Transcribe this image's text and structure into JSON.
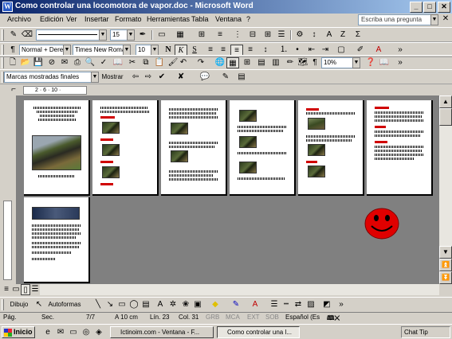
{
  "window": {
    "title": "Como controlar una locomotora  de vapor.doc - Microsoft Word",
    "app_icon": "word-icon"
  },
  "menubar": {
    "items": [
      "Archivo",
      "Edición",
      "Ver",
      "Insertar",
      "Formato",
      "Herramientas",
      "Tabla",
      "Ventana",
      "?"
    ],
    "ask_placeholder": "Escriba una pregunta"
  },
  "toolbar_draw_top": {
    "zoom_line": "",
    "font_size": "15"
  },
  "toolbar_format": {
    "style": "Normal + Derec",
    "font": "Times New Roman",
    "size": "10"
  },
  "toolbar_standard": {
    "zoom": "10%"
  },
  "toolbar_review": {
    "markup_view": "Marcas mostradas finales",
    "show_label": "Mostrar"
  },
  "ruler": {
    "marks": "2 · 6 · 10 ·"
  },
  "document": {
    "page_count": 7,
    "page1": {
      "title_lines": 3
    }
  },
  "drawbar": {
    "draw_label": "Dibujo",
    "autoshapes_label": "Autoformas"
  },
  "statusbar": {
    "page": "Pág.",
    "section": "Sec.",
    "pages": "7/7",
    "at": "A 10 cm",
    "line": "Lín. 23",
    "col": "Col. 31",
    "grb": "GRB",
    "mca": "MCA",
    "ext": "EXT",
    "sob": "SOB",
    "lang": "Español (Es"
  },
  "taskbar": {
    "start": "Inicio",
    "tasks": [
      "Ictinoim.com - Ventana - F...",
      "Como controlar una l..."
    ],
    "clock": "Chat Tip"
  },
  "colors": {
    "title_start": "#0a246a",
    "title_end": "#a6caf0",
    "doc_bg": "#808080",
    "smiley": "#e00000"
  }
}
